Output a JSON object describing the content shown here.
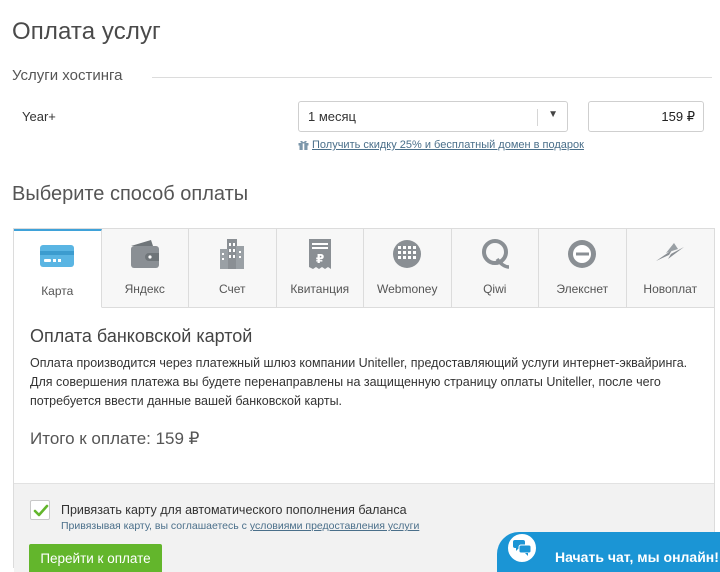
{
  "page": {
    "title": "Оплата услуг"
  },
  "hosting": {
    "section_label": "Услуги хостинга",
    "service_name": "Year+",
    "period_value": "1 месяц",
    "price": "159 ₽",
    "discount_text": "Получить скидку 25% и бесплатный домен в подарок"
  },
  "payment": {
    "title": "Выберите способ оплаты",
    "active_tab": "Карта",
    "tabs": [
      {
        "label": "Карта",
        "icon": "credit-card-icon"
      },
      {
        "label": "Яндекс",
        "icon": "wallet-icon"
      },
      {
        "label": "Счет",
        "icon": "building-icon"
      },
      {
        "label": "Квитанция",
        "icon": "receipt-icon"
      },
      {
        "label": "Webmoney",
        "icon": "webmoney-icon"
      },
      {
        "label": "Qiwi",
        "icon": "qiwi-icon"
      },
      {
        "label": "Элекснет",
        "icon": "eleksnet-icon"
      },
      {
        "label": "Новоплат",
        "icon": "novoplat-icon"
      }
    ],
    "card_title": "Оплата банковской картой",
    "card_description": "Оплата производится через платежный шлюз компании Uniteller, предоставляющий услуги интернет-эквайринга. Для совершения платежа вы будете перенаправлены на защищенную страницу оплаты Uniteller, после чего потребуется ввести данные вашей банковской карты.",
    "total": "Итого к оплате: 159 ₽",
    "bind_card_label": "Привязать карту для автоматического пополнения баланса",
    "bind_note_prefix": "Привязывая карту, вы соглашаетесь с ",
    "bind_note_link": "условиями предоставления услуги",
    "bind_checked": true,
    "submit_label": "Перейти к оплате"
  },
  "chat": {
    "label": "Начать чат, мы онлайн!",
    "icon": "chat-bubble-icon"
  },
  "colors": {
    "accent": "#3fa2d9",
    "button": "#63b62c",
    "chat": "#1b95d5",
    "icon": "#8a8f94"
  }
}
